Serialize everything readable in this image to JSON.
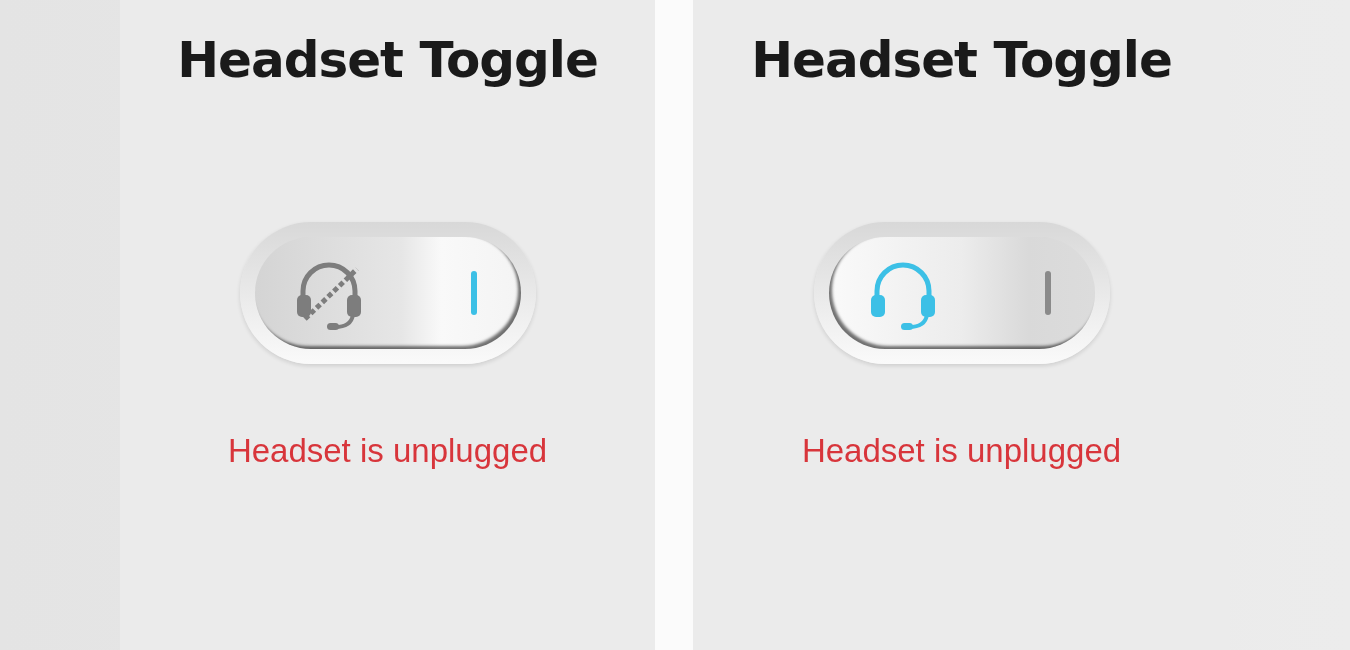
{
  "screens": [
    {
      "title": "Headset Toggle",
      "toggle": {
        "on": false
      },
      "status": "Headset is unplugged"
    },
    {
      "title": "Headset Toggle",
      "toggle": {
        "on": true
      },
      "status": "Headset is unplugged"
    }
  ]
}
